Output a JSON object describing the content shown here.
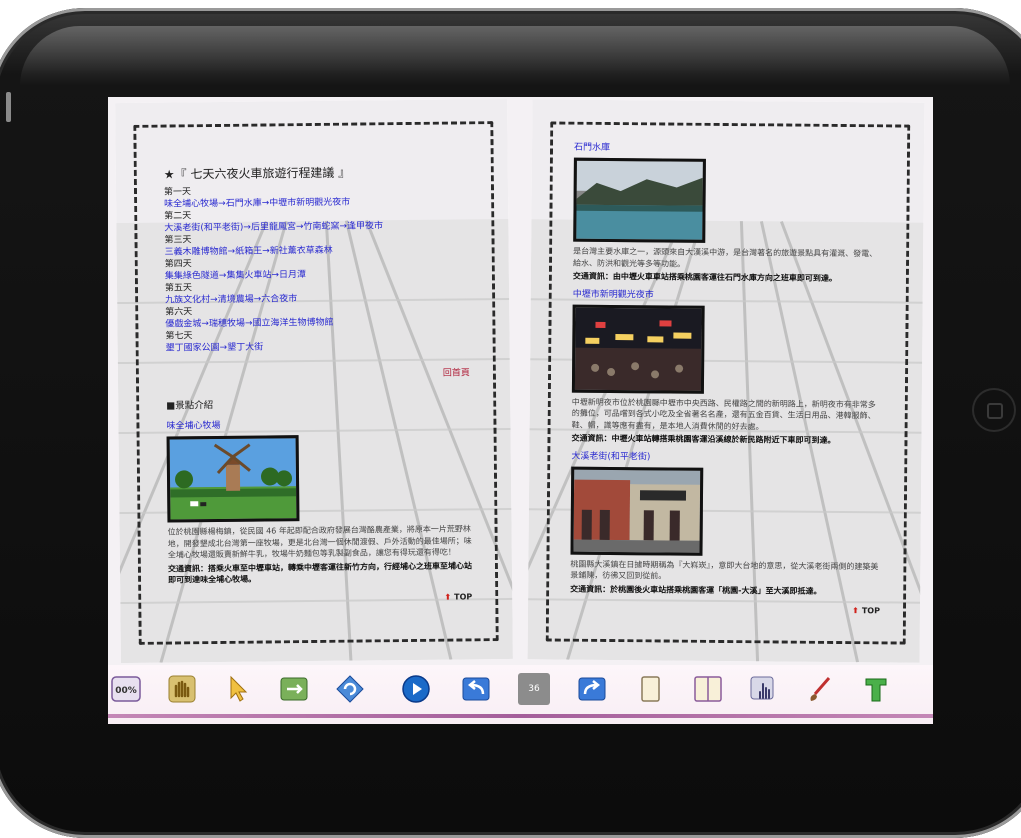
{
  "left_page": {
    "title": "★『 七天六夜火車旅遊行程建議 』",
    "itinerary": [
      {
        "day": "第一天",
        "route": "味全埔心牧場→石門水庫→中壢市新明觀光夜市"
      },
      {
        "day": "第二天",
        "route": "大溪老街(和平老街)→后里龍鳳宮→竹南蛇窯→逢甲夜市"
      },
      {
        "day": "第三天",
        "route": "三義木雕博物館→紙箱王→新社薰衣草森林"
      },
      {
        "day": "第四天",
        "route": "集集綠色隧道→集集火車站→日月潭"
      },
      {
        "day": "第五天",
        "route": "九族文化村→清境農場→六合夜市"
      },
      {
        "day": "第六天",
        "route": "優戲金城→瑞穗牧場→國立海洋生物博物館"
      },
      {
        "day": "第七天",
        "route": "墾丁國家公園→墾丁大街"
      }
    ],
    "back_home": "回首頁",
    "section_head": "■景點介紹",
    "place_name": "味全埔心牧場",
    "description": "位於桃園縣楊梅鎮，從民國 46 年起即配合政府發展台灣酪農產業，將原本一片荒野林地，開發墾成北台灣第一座牧場，更是北台灣一個休閒渡假、戶外活動的最佳場所；味全埔心牧場還販賣新鮮牛乳，牧場牛奶麵包等乳製副食品，讓您有得玩還有得吃！",
    "traffic": "交通資訊：搭乘火車至中壢車站，轉乘中壢客運往新竹方向，行經埔心之班車至埔心站即可到達味全埔心牧場。",
    "top_label": "TOP"
  },
  "right_page": {
    "places": [
      {
        "name": "石門水庫",
        "description": "是台灣主要水庫之一，源頭來自大漢溪中游，是台灣著名的旅遊景點具有灌溉、發電、給水、防洪和觀光等多等功能。",
        "traffic": "交通資訊：由中壢火車車站搭乘桃園客運往石門水庫方向之班車即可到達。"
      },
      {
        "name": "中壢市新明觀光夜市",
        "description": "中壢新明夜市位於桃園縣中壢市中央西路、民權路之間的新明路上，新明夜市有非常多的攤位，可品嚐到各式小吃及全省著名名產，還有五金百貨、生活日用品、港韓服飾、鞋、帽，識等應有盡有，是本地人消費休閒的好去處。",
        "traffic": "交通資訊：中壢火車站轉搭乘桃園客運沿溪線於新民路附近下車即可到達。"
      },
      {
        "name": "大溪老街(和平老街)",
        "description": "桃園縣大溪鎮在日據時期稱為『大嵙崁』，意即大台地的意思，從大溪老街兩側的建築美景鋪陳，彷彿又回到從前。",
        "traffic": "交通資訊：於桃園後火車站搭乘桃園客運「桃園-大溪」至大溪即抵達。"
      }
    ],
    "top_label": "TOP"
  },
  "toolbar": {
    "page_number": "36",
    "zoom_label": "00%",
    "tools": [
      "zoom-tool",
      "hand-tool",
      "pointer-tool",
      "fit-page-tool",
      "rotate-tool",
      "play-button",
      "back-button",
      "next-button",
      "single-page-tool",
      "double-page-tool",
      "touch-tool",
      "brush-tool",
      "text-tool"
    ]
  },
  "colors": {
    "link_blue": "#2a2ad0",
    "back_home_red": "#b0203a",
    "toolbar_accent": "#a45e9a",
    "frame": "#111111"
  }
}
